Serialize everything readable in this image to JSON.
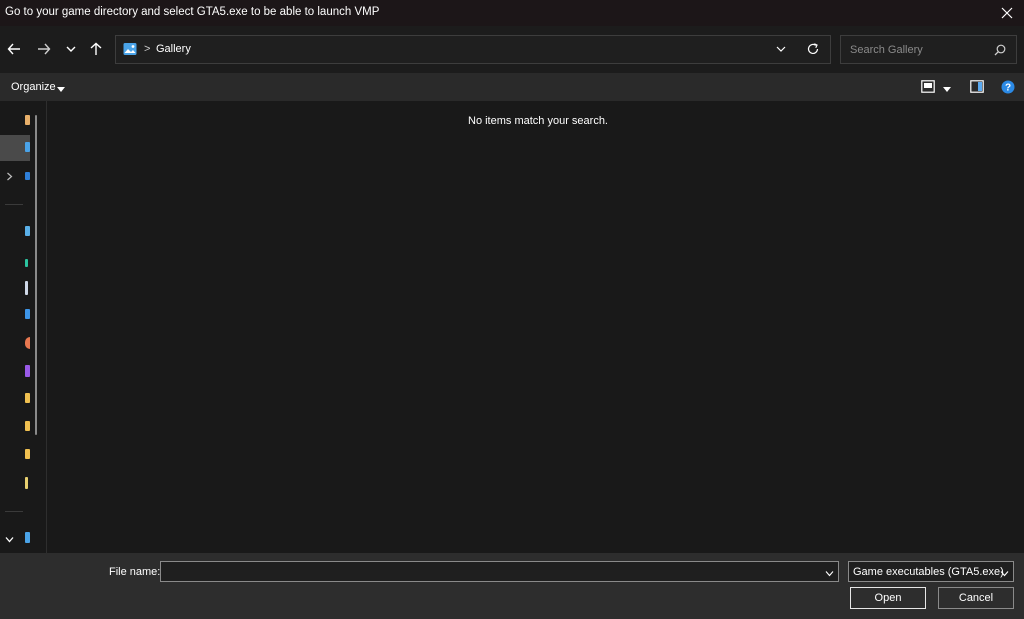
{
  "window": {
    "title": "Go to your game directory and select GTA5.exe to be able to launch VMP"
  },
  "nav": {
    "icons": [
      "back-arrow-icon",
      "forward-arrow-icon",
      "chevron-down-icon",
      "up-arrow-icon"
    ]
  },
  "address": {
    "separator": ">",
    "location": "Gallery"
  },
  "search": {
    "placeholder": "Search Gallery"
  },
  "toolbar": {
    "organize_label": "Organize"
  },
  "content": {
    "empty_message": "No items match your search."
  },
  "footer": {
    "file_name_label": "File name:",
    "file_name_value": "",
    "filter_selected": "Game executables (GTA5.exe)",
    "open_label": "Open",
    "cancel_label": "Cancel"
  },
  "colors": {
    "accent": "#0078d4",
    "help": "#2b8ae6"
  }
}
